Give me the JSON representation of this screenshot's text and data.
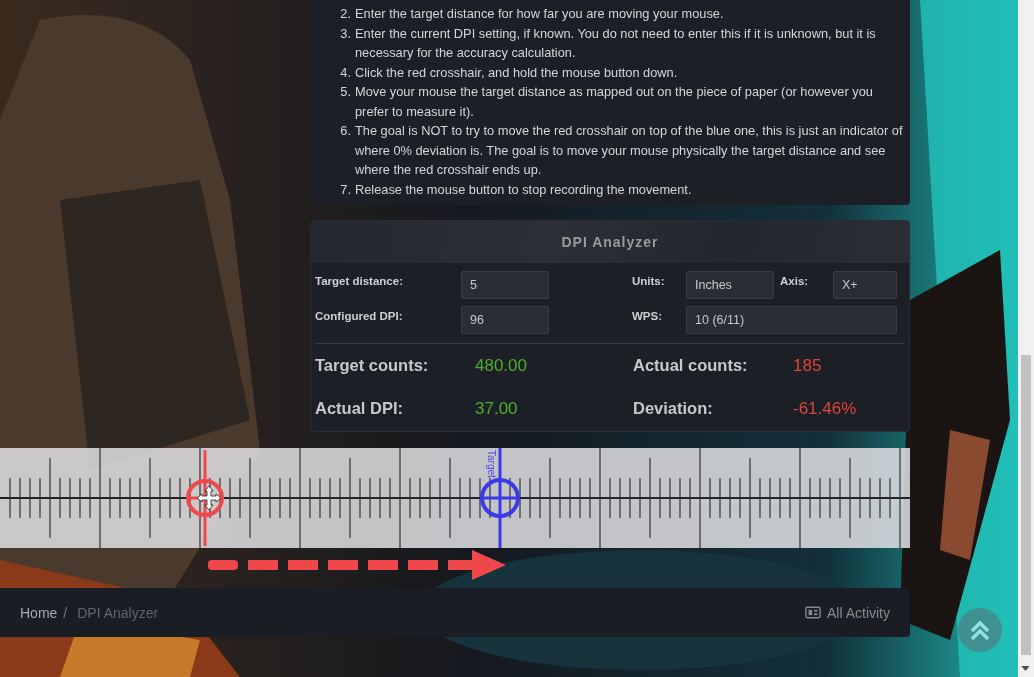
{
  "instructions": [
    {
      "number": "2.",
      "text": "Enter the target distance for how far you are moving your mouse."
    },
    {
      "number": "3.",
      "text": "Enter the current DPI setting, if known. You do not need to enter this if it is unknown, but it is necessary for the accuracy calculation."
    },
    {
      "number": "4.",
      "text": "Click the red crosshair, and hold the mouse button down."
    },
    {
      "number": "5.",
      "text": "Move your mouse the target distance as mapped out on the piece of paper (or however you prefer to measure it)."
    },
    {
      "number": "6.",
      "text": "The goal is NOT to try to move the red crosshair on top of the blue one, this is just an indicator of where 0% deviation is. The goal is to move your mouse physically the target distance and see where the red crosshair ends up."
    },
    {
      "number": "7.",
      "text": "Release the mouse button to stop recording the movement."
    }
  ],
  "analyzer": {
    "title": "DPI Analyzer",
    "field_rows": [
      [
        {
          "label": "Target distance:",
          "value": "5"
        },
        {
          "label": "Units:",
          "value": "Inches"
        },
        {
          "label": "Axis:",
          "value": "X+"
        }
      ],
      [
        {
          "label": "Configured DPI:",
          "value": "96"
        },
        {
          "label": "WPS:",
          "value": "10 (6/11)"
        }
      ]
    ],
    "results": [
      {
        "label": "Target counts:",
        "value": "480.00",
        "color": "#4caf2a"
      },
      {
        "label": "Actual counts:",
        "value": "185",
        "color": "#e0443a"
      },
      {
        "label": "Actual DPI:",
        "value": "37.00",
        "color": "#4caf2a"
      },
      {
        "label": "Deviation:",
        "value": "-61.46%",
        "color": "#e0443a"
      }
    ]
  },
  "ruler": {
    "target_label": "Target"
  },
  "breadcrumb_separator": "/",
  "breadcrumb": [
    {
      "label": "Home",
      "current": false
    },
    {
      "label": "DPI Analyzer",
      "current": true
    }
  ],
  "activity_link": "All Activity"
}
